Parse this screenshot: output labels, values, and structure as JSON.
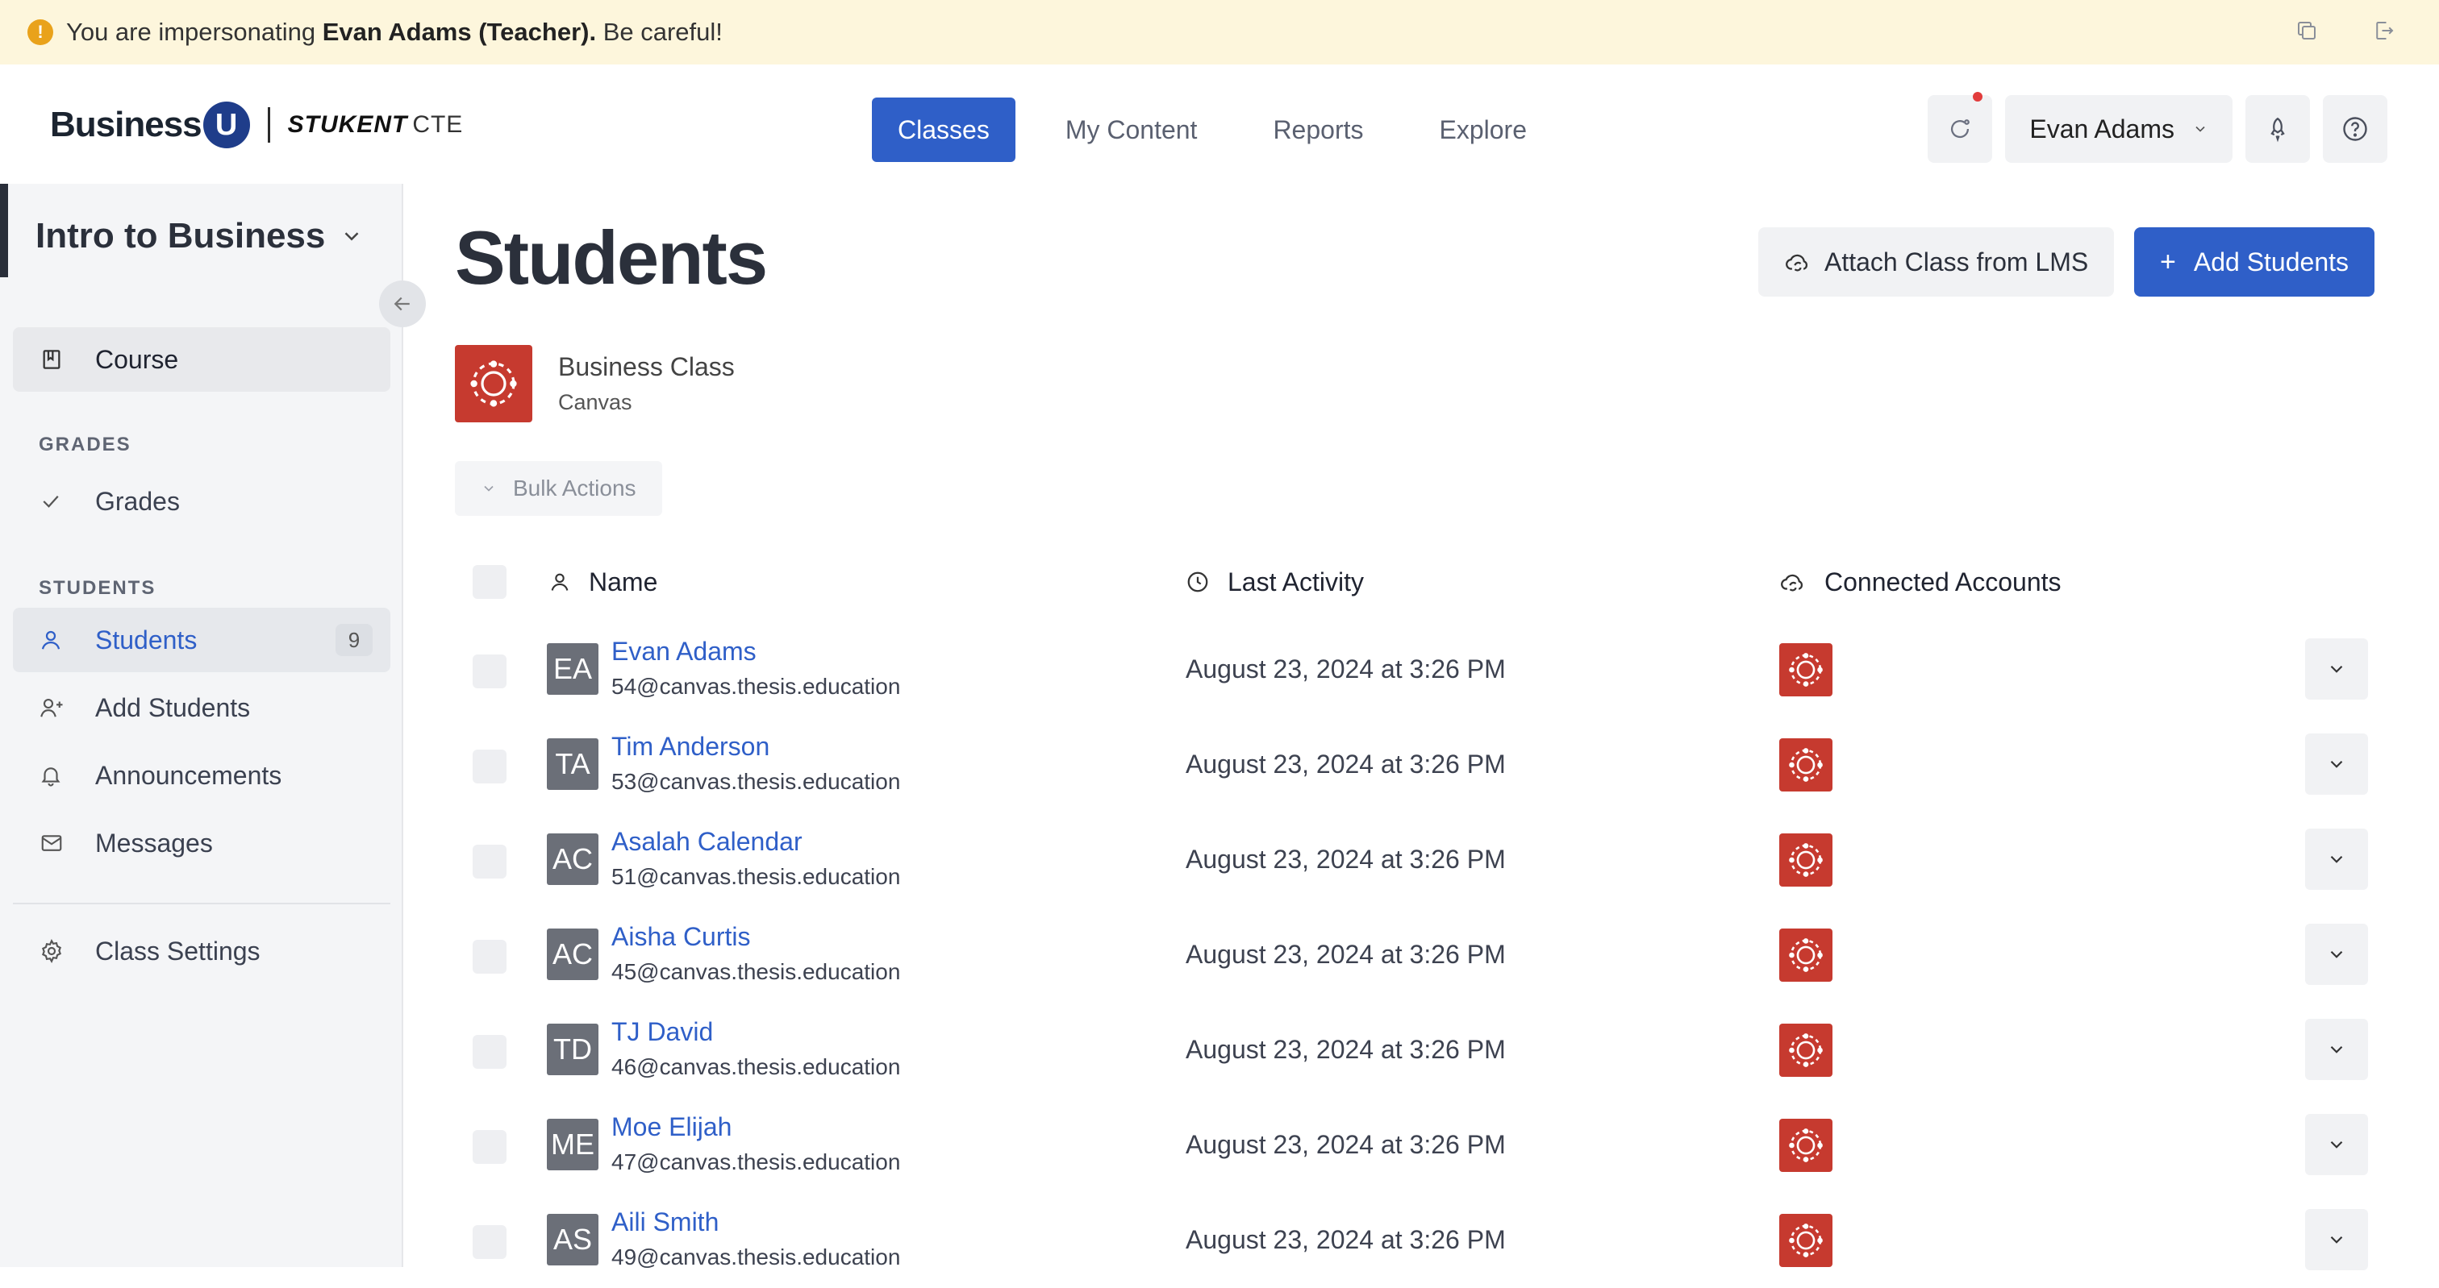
{
  "banner": {
    "prefix": "You are impersonating ",
    "who": "Evan Adams (Teacher).",
    "suffix": " Be careful!",
    "icons": [
      "copy-icon",
      "exit-icon"
    ]
  },
  "header": {
    "logo": {
      "business": "Business",
      "u": "U",
      "stukent": "STUKENT",
      "cte": "CTE"
    },
    "nav": [
      {
        "label": "Classes",
        "active": true
      },
      {
        "label": "My Content",
        "active": false
      },
      {
        "label": "Reports",
        "active": false
      },
      {
        "label": "Explore",
        "active": false
      }
    ],
    "user": "Evan Adams"
  },
  "sidebar": {
    "class_name": "Intro to Business",
    "course_label": "Course",
    "grades_group": "GRADES",
    "grades_label": "Grades",
    "students_group": "STUDENTS",
    "students_label": "Students",
    "students_count": "9",
    "add_students_label": "Add Students",
    "announcements_label": "Announcements",
    "messages_label": "Messages",
    "class_settings_label": "Class Settings"
  },
  "main": {
    "title": "Students",
    "attach_label": "Attach Class from LMS",
    "add_label": "Add Students",
    "lms": {
      "name": "Business Class",
      "provider": "Canvas"
    },
    "bulk_label": "Bulk Actions",
    "columns": {
      "name": "Name",
      "activity": "Last Activity",
      "accounts": "Connected Accounts"
    },
    "students": [
      {
        "initials": "EA",
        "name": "Evan Adams",
        "email": "54@canvas.thesis.education",
        "last_activity": "August 23, 2024 at 3:26 PM"
      },
      {
        "initials": "TA",
        "name": "Tim Anderson",
        "email": "53@canvas.thesis.education",
        "last_activity": "August 23, 2024 at 3:26 PM"
      },
      {
        "initials": "AC",
        "name": "Asalah Calendar",
        "email": "51@canvas.thesis.education",
        "last_activity": "August 23, 2024 at 3:26 PM"
      },
      {
        "initials": "AC",
        "name": "Aisha Curtis",
        "email": "45@canvas.thesis.education",
        "last_activity": "August 23, 2024 at 3:26 PM"
      },
      {
        "initials": "TD",
        "name": "TJ David",
        "email": "46@canvas.thesis.education",
        "last_activity": "August 23, 2024 at 3:26 PM"
      },
      {
        "initials": "ME",
        "name": "Moe Elijah",
        "email": "47@canvas.thesis.education",
        "last_activity": "August 23, 2024 at 3:26 PM"
      },
      {
        "initials": "AS",
        "name": "Aili Smith",
        "email": "49@canvas.thesis.education",
        "last_activity": "August 23, 2024 at 3:26 PM"
      }
    ]
  },
  "colors": {
    "accent": "#2f5fc8",
    "canvas_red": "#c63a2f",
    "banner": "#fdf6dc",
    "warning": "#e9a21b"
  }
}
